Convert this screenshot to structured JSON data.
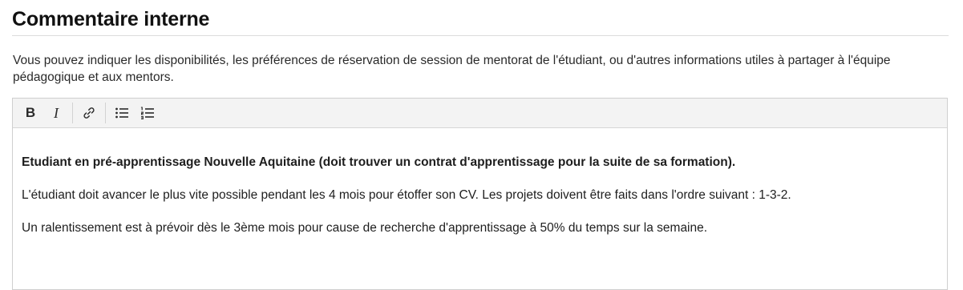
{
  "section": {
    "title": "Commentaire interne",
    "help_text": "Vous pouvez indiquer les disponibilités, les préférences de réservation de session de mentorat de l'étudiant, ou d'autres informations utiles à partager à l'équipe pédagogique et aux mentors."
  },
  "editor": {
    "toolbar": {
      "bold_glyph": "B",
      "italic_glyph": "I",
      "icons": [
        "bold-icon",
        "italic-icon",
        "link-icon",
        "bullet-list-icon",
        "numbered-list-icon"
      ]
    },
    "paragraphs": [
      "Etudiant en pré-apprentissage Nouvelle Aquitaine (doit trouver un contrat d'apprentissage pour la suite de sa formation).",
      "L'étudiant doit avancer le plus vite possible pendant les 4 mois pour étoffer son CV. Les projets doivent être faits dans l'ordre suivant : 1-3-2.",
      "Un ralentissement est à prévoir dès le 3ème mois pour cause de recherche d'apprentissage à 50% du temps sur la semaine."
    ]
  }
}
